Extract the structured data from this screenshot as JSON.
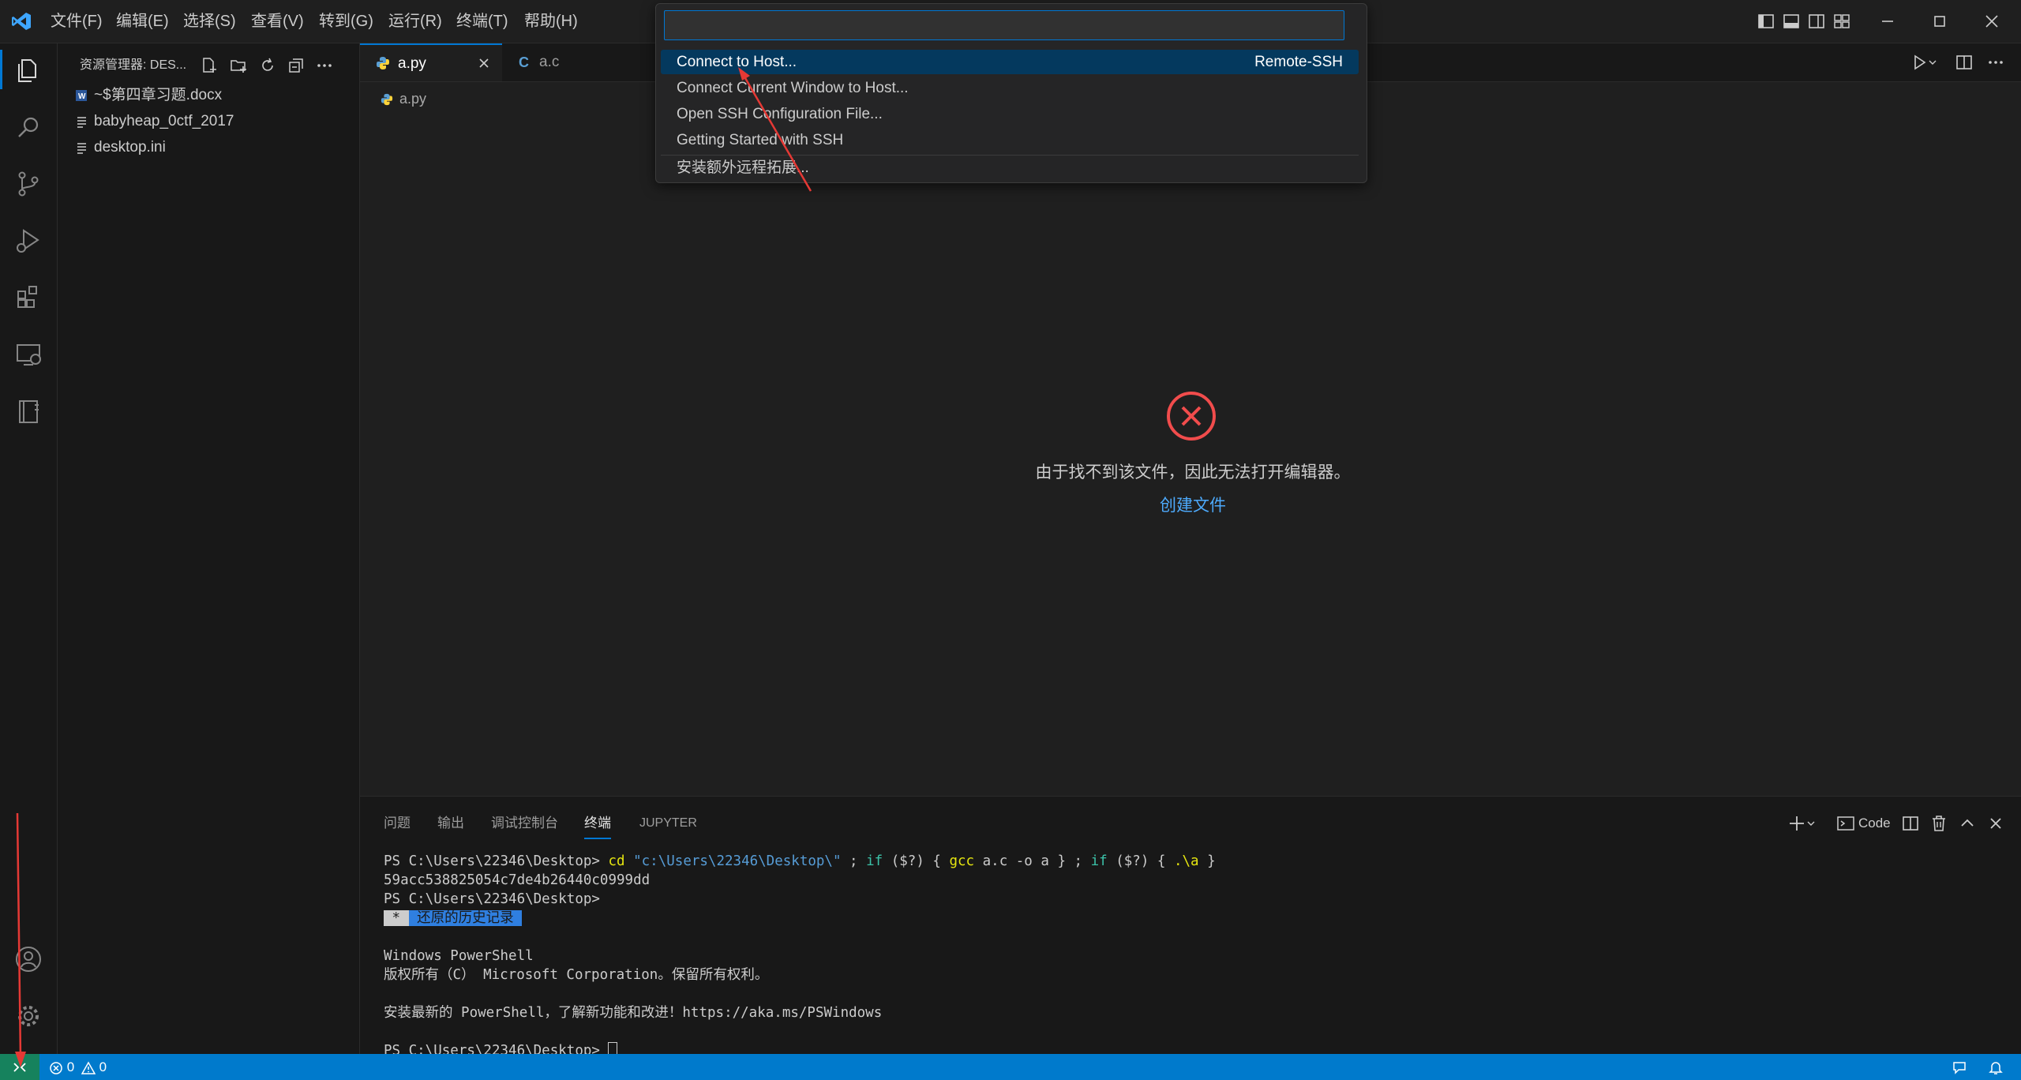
{
  "titlebar": {
    "menus": [
      "文件(F)",
      "编辑(E)",
      "选择(S)",
      "查看(V)",
      "转到(G)",
      "运行(R)",
      "终端(T)",
      "帮助(H)"
    ]
  },
  "quickpick": {
    "input_value": "",
    "items": [
      {
        "label": "Connect to Host...",
        "detail": "Remote-SSH"
      },
      {
        "label": "Connect Current Window to Host...",
        "detail": ""
      },
      {
        "label": "Open SSH Configuration File...",
        "detail": ""
      },
      {
        "label": "Getting Started with SSH",
        "detail": ""
      },
      {
        "label": "安装额外远程拓展...",
        "detail": ""
      }
    ]
  },
  "sidebar": {
    "title": "资源管理器: DES...",
    "files": [
      {
        "name": "~$第四章习题.docx",
        "icon": "word-file-icon"
      },
      {
        "name": "babyheap_0ctf_2017",
        "icon": "text-file-icon"
      },
      {
        "name": "desktop.ini",
        "icon": "text-file-icon"
      }
    ]
  },
  "tabs": [
    {
      "label": "a.py",
      "icon": "python-icon",
      "active": true
    },
    {
      "label": "a.c",
      "icon": "c-icon",
      "active": false
    }
  ],
  "editor": {
    "breadcrumb": "a.py",
    "error_message": "由于找不到该文件，因此无法打开编辑器。",
    "create_file_link": "创建文件"
  },
  "panel": {
    "tabs": [
      "问题",
      "输出",
      "调试控制台",
      "终端",
      "JUPYTER"
    ],
    "active_tab": "终端",
    "terminal_profile": "Code",
    "terminal": {
      "line1_prompt": "PS C:\\Users\\22346\\Desktop> ",
      "line1_cd": "cd",
      "line1_path": " \"c:\\Users\\22346\\Desktop\\\"",
      "line1_semi1": " ; ",
      "line1_if1": "if",
      "line1_cond1": " ($?) { ",
      "line1_gcc": "gcc",
      "line1_gccargs": " a.c -o a } ; ",
      "line1_if2": "if",
      "line1_cond2": " ($?) { ",
      "line1_run": ".\\a",
      "line1_end": " }",
      "line2": "59acc538825054c7de4b26440c0999dd",
      "line3": "PS C:\\Users\\22346\\Desktop>",
      "history_star": " * ",
      "history_label": " 还原的历史记录 ",
      "line5": "Windows PowerShell",
      "line6": "版权所有（C） Microsoft Corporation。保留所有权利。",
      "line7": "安装最新的 PowerShell，了解新功能和改进！https://aka.ms/PSWindows",
      "line8": "PS C:\\Users\\22346\\Desktop> "
    }
  },
  "statusbar": {
    "errors": "0",
    "warnings": "0"
  },
  "colors": {
    "accent": "#007acc",
    "selection": "#04395e",
    "error": "#f14c4c",
    "link": "#4daafc",
    "arrow": "#e53935"
  }
}
